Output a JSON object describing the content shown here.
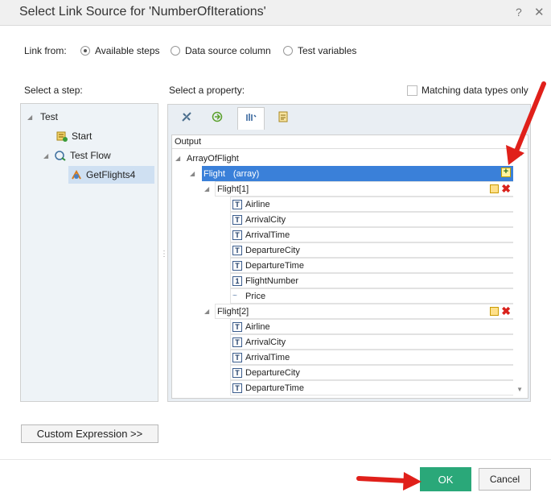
{
  "window": {
    "title": "Select Link Source for 'NumberOfIterations'",
    "help": "?",
    "close": "✕"
  },
  "link_from": {
    "label": "Link from:",
    "options": [
      {
        "label": "Available steps",
        "selected": true
      },
      {
        "label": "Data source column",
        "selected": false
      },
      {
        "label": "Test variables",
        "selected": false
      }
    ]
  },
  "select_step_label": "Select a step:",
  "select_property_label": "Select a property:",
  "matching_label": "Matching data types only",
  "steps": [
    {
      "label": "Test"
    },
    {
      "label": "Start"
    },
    {
      "label": "Test Flow"
    },
    {
      "label": "GetFlights4"
    }
  ],
  "tabs": [
    "properties-tab",
    "input-tab",
    "output-tab",
    "attachments-tab"
  ],
  "output": {
    "header": "Output",
    "root": "ArrayOfFlight",
    "flight_name": "Flight",
    "flight_type": "(array)",
    "items": [
      {
        "label": "Flight[1]",
        "fields": [
          {
            "icon": "T",
            "name": "Airline"
          },
          {
            "icon": "T",
            "name": "ArrivalCity"
          },
          {
            "icon": "T",
            "name": "ArrivalTime"
          },
          {
            "icon": "T",
            "name": "DepartureCity"
          },
          {
            "icon": "T",
            "name": "DepartureTime"
          },
          {
            "icon": "1",
            "name": "FlightNumber"
          },
          {
            "icon": "~",
            "name": "Price"
          }
        ]
      },
      {
        "label": "Flight[2]",
        "fields": [
          {
            "icon": "T",
            "name": "Airline"
          },
          {
            "icon": "T",
            "name": "ArrivalCity"
          },
          {
            "icon": "T",
            "name": "ArrivalTime"
          },
          {
            "icon": "T",
            "name": "DepartureCity"
          },
          {
            "icon": "T",
            "name": "DepartureTime"
          }
        ]
      }
    ]
  },
  "buttons": {
    "custom": "Custom Expression >>",
    "ok": "OK",
    "cancel": "Cancel"
  },
  "colors": {
    "ok": "#2aa879",
    "highlight": "#3a80d9",
    "arrow": "#e0201a"
  }
}
